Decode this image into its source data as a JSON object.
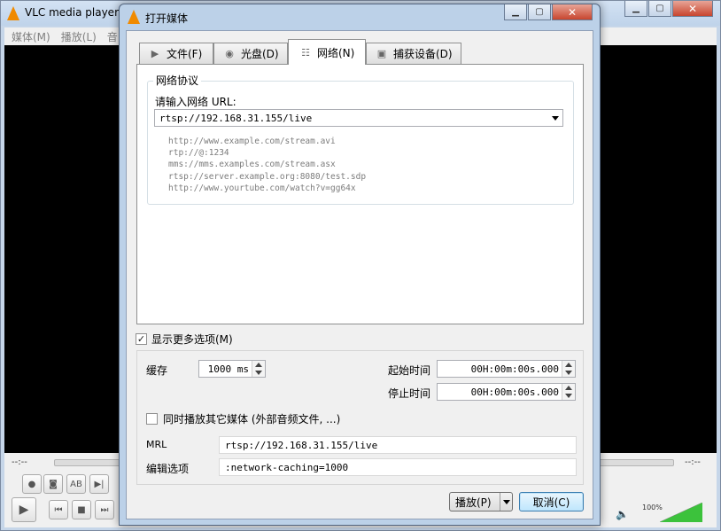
{
  "vlc": {
    "title": "VLC media player",
    "menu": [
      "媒体(M)",
      "播放(L)",
      "音"
    ],
    "time_elapsed": "--:--",
    "time_total": "--:--",
    "volume_text": "100%",
    "volume_level_pct": 100
  },
  "dialog": {
    "title": "打开媒体",
    "tabs": [
      {
        "label": "文件(F)",
        "icon": "file-icon"
      },
      {
        "label": "光盘(D)",
        "icon": "disc-icon"
      },
      {
        "label": "网络(N)",
        "icon": "network-icon"
      },
      {
        "label": "捕获设备(D)",
        "icon": "capture-device-icon"
      }
    ],
    "active_tab": "网络(N)",
    "network": {
      "group_title": "网络协议",
      "url_label": "请输入网络 URL:",
      "url_value": "rtsp://192.168.31.155/live",
      "examples": [
        "http://www.example.com/stream.avi",
        "rtp://@:1234",
        "mms://mms.examples.com/stream.asx",
        "rtsp://server.example.org:8080/test.sdp",
        "http://www.yourtube.com/watch?v=gg64x"
      ]
    },
    "show_more": {
      "label": "显示更多选项(M)",
      "checked": "✓"
    },
    "options": {
      "cache_label": "缓存",
      "cache_value": "1000 ms",
      "start_label": "起始时间",
      "start_value": "00H:00m:00s.000",
      "stop_label": "停止时间",
      "stop_value": "00H:00m:00s.000",
      "sync_label": "同时播放其它媒体 (外部音频文件, ...)",
      "mrl_label": "MRL",
      "mrl_value": "rtsp://192.168.31.155/live",
      "edit_label": "编辑选项",
      "edit_value": ":network-caching=1000"
    },
    "buttons": {
      "play": "播放(P)",
      "cancel": "取消(C)"
    }
  }
}
